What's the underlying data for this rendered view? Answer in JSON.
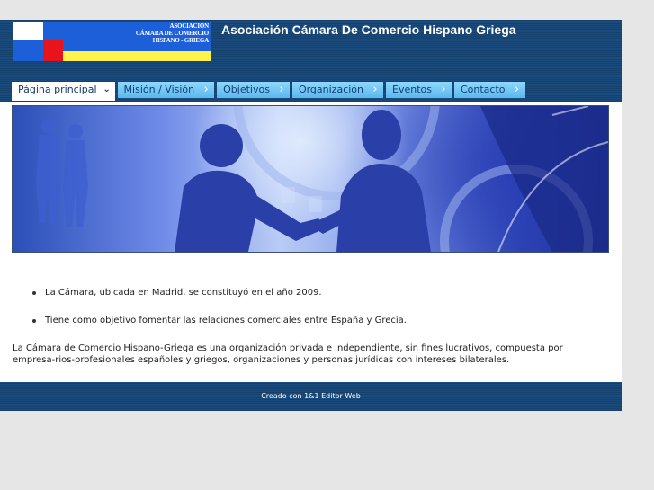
{
  "site": {
    "logo_lines": [
      "ASOCIACIÓN",
      "CÁMARA DE COMERCIO",
      "HISPANO - GRIEGA"
    ],
    "title": "Asociación Cámara De Comercio Hispano Griega"
  },
  "nav": {
    "tabs": [
      {
        "label": "Página principal",
        "active": true
      },
      {
        "label": "Misión / Visión",
        "active": false
      },
      {
        "label": "Objetivos",
        "active": false
      },
      {
        "label": "Organización",
        "active": false
      },
      {
        "label": "Eventos",
        "active": false
      },
      {
        "label": "Contacto",
        "active": false
      }
    ]
  },
  "content": {
    "bullets": [
      "La Cámara, ubicada en Madrid, se constituyó en el año 2009.",
      "Tiene como objetivo fomentar las relaciones comerciales entre España y Grecia."
    ],
    "paragraph": "La Cámara de Comercio Hispano-Griega es una organización privada e independiente, sin fines lucrativos, compuesta por empresa-rios-profesionales españoles y griegos, organizaciones y personas jurídicas con intereses bilaterales."
  },
  "footer": {
    "text": "Creado con 1&1 Editor Web"
  },
  "colors": {
    "header_bg": "#1a4b7c",
    "tab_bg": "#7ccaf5",
    "logo_blue": "#1c5fd9",
    "logo_red": "#e8131b",
    "logo_yellow": "#fff24a"
  }
}
